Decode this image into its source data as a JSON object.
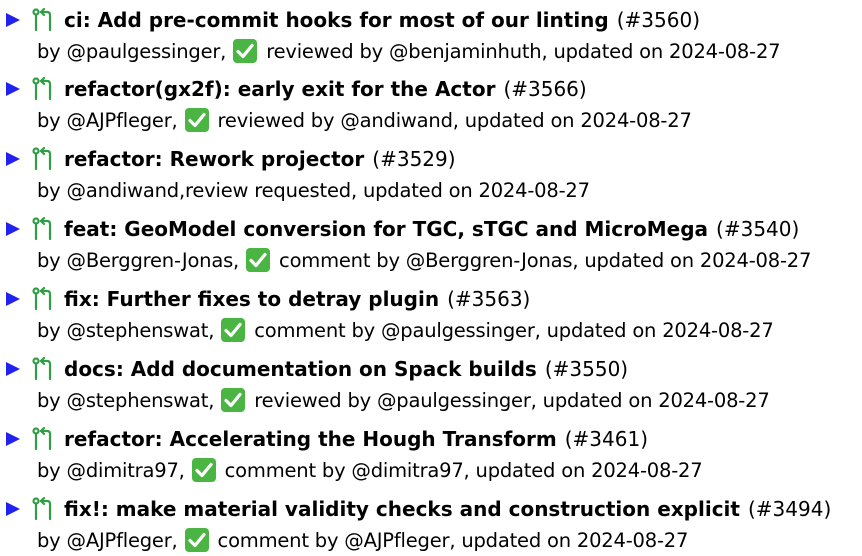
{
  "colors": {
    "arrow": "#2222ee",
    "pr_icon": "#2f9e44",
    "check_bg": "#4bb543",
    "text": "#000000"
  },
  "icons": {
    "expand": "triangle-right-icon",
    "pr": "git-pull-request-icon",
    "approved": "check-mark-icon"
  },
  "pull_requests": [
    {
      "title": "ci: Add pre-commit hooks for most of our linting",
      "number": "(#3560)",
      "meta_pre": "by @paulgessinger,",
      "has_check": true,
      "meta_post": "reviewed by @benjaminhuth, updated on 2024-08-27"
    },
    {
      "title": "refactor(gx2f): early exit for the Actor",
      "number": "(#3566)",
      "meta_pre": "by @AJPfleger,",
      "has_check": true,
      "meta_post": "reviewed by @andiwand, updated on 2024-08-27"
    },
    {
      "title": "refactor: Rework projector",
      "number": "(#3529)",
      "meta_pre": "by @andiwand,review requested, updated on 2024-08-27",
      "has_check": false,
      "meta_post": ""
    },
    {
      "title": "feat: GeoModel conversion for TGC, sTGC and MicroMega",
      "number": "(#3540)",
      "meta_pre": "by @Berggren-Jonas,",
      "has_check": true,
      "meta_post": "comment by @Berggren-Jonas, updated on 2024-08-27"
    },
    {
      "title": "fix: Further fixes to detray plugin",
      "number": "(#3563)",
      "meta_pre": "by @stephenswat,",
      "has_check": true,
      "meta_post": "comment by @paulgessinger, updated on 2024-08-27"
    },
    {
      "title": "docs: Add documentation on Spack builds",
      "number": "(#3550)",
      "meta_pre": "by @stephenswat,",
      "has_check": true,
      "meta_post": "reviewed by @paulgessinger, updated on 2024-08-27"
    },
    {
      "title": "refactor: Accelerating the Hough Transform",
      "number": "(#3461)",
      "meta_pre": "by @dimitra97,",
      "has_check": true,
      "meta_post": "comment by @dimitra97, updated on 2024-08-27"
    },
    {
      "title": "fix!: make material validity checks and construction explicit",
      "number": "(#3494)",
      "meta_pre": "by @AJPfleger,",
      "has_check": true,
      "meta_post": "comment by @AJPfleger, updated on 2024-08-27"
    }
  ]
}
